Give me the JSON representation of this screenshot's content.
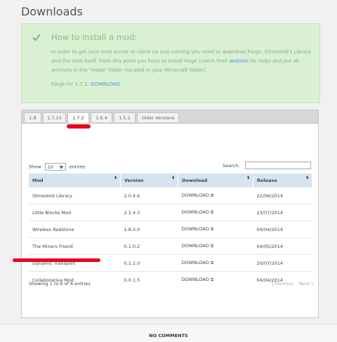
{
  "page": {
    "title": "Downloads"
  },
  "notice": {
    "heading": "How to install a mod:",
    "text_before_link": "In order to get your mod server or client up and running you need to download Forge, SlimeVoid's Library and the mod itself. From this point you have to install forge (check their ",
    "link": "website",
    "text_after_link": " for help) and put all archives in the \"mods\" folder (located in your Minecraft folder).",
    "forge_label": "Forge for 1.7.2:",
    "forge_link": "DOWNLOAD",
    "accent_color": "#8bbd82"
  },
  "tabs": [
    {
      "label": "1.8",
      "active": false
    },
    {
      "label": "1.7.10",
      "active": false
    },
    {
      "label": "1.7.2",
      "active": true
    },
    {
      "label": "1.6.4",
      "active": false
    },
    {
      "label": "1.5.2",
      "active": false
    },
    {
      "label": "Older Versions",
      "active": false
    }
  ],
  "table_controls": {
    "show_label": "Show",
    "entries_value": "10",
    "entries_label": "entries",
    "search_label": "Search:"
  },
  "table": {
    "headers": [
      "Mod",
      "Version",
      "Download",
      "Release"
    ],
    "rows": [
      {
        "mod": "SlimeVoid Library",
        "version": "2.0.4.6",
        "download": "DOWNLOAD",
        "release": "22/06/2014"
      },
      {
        "mod": "Little Blocks Mod",
        "version": "2.2.4.3",
        "download": "DOWNLOAD",
        "release": "23/07/2014"
      },
      {
        "mod": "Wireless Redstone",
        "version": "1.8.0.0",
        "download": "DOWNLOAD",
        "release": "04/04/2014"
      },
      {
        "mod": "The Miners Friend",
        "version": "0.1.0.2",
        "download": "DOWNLOAD",
        "release": "04/05/2014"
      },
      {
        "mod": "Dynamic Transport",
        "version": "0.1.2.0",
        "download": "DOWNLOAD",
        "release": "20/07/2014"
      },
      {
        "mod": "Collaborative Mod",
        "version": "0.0.1.5",
        "download": "DOWNLOAD",
        "release": "04/04/2014"
      }
    ],
    "header_color": "#d6e4f2"
  },
  "footer": {
    "info": "Showing 1 to 6 of 6 entries",
    "previous": "Previous",
    "next": "Next"
  },
  "comments": "NO COMMENTS",
  "annotation_color": "#e8001c"
}
